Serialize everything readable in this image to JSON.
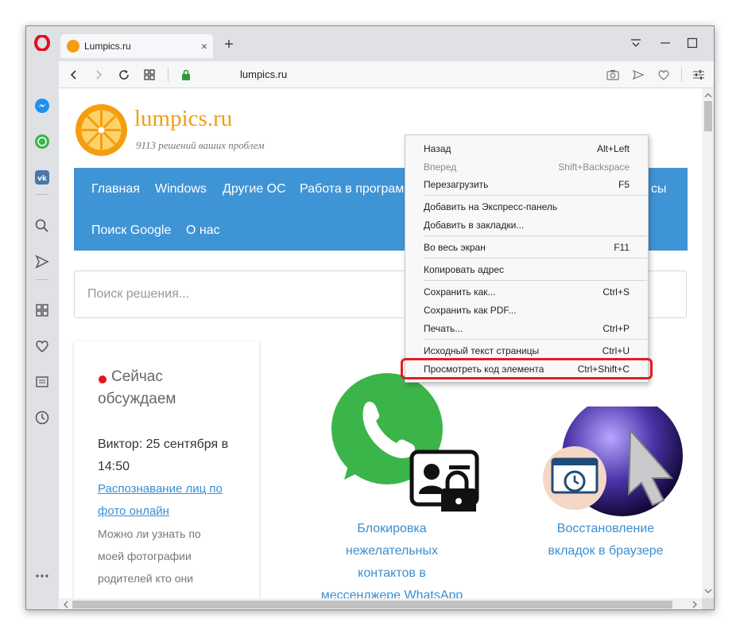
{
  "tab": {
    "title": "Lumpics.ru",
    "close": "×",
    "new": "+"
  },
  "address": {
    "url": "lumpics.ru"
  },
  "site": {
    "title": "lumpics.ru",
    "subtitle": "9113 решений ваших проблем",
    "nav": [
      "Главная",
      "Windows",
      "Другие ОС",
      "Работа в програм",
      "сы",
      "Поиск Google",
      "О нас"
    ],
    "search_placeholder": "Поиск решения..."
  },
  "card": {
    "heading1": "Сейчас",
    "heading2": "обсуждаем",
    "author1": "Виктор: 25 сентября в",
    "author2": "14:50",
    "link1": "Распознавание лиц по",
    "link2": "фото онлайн",
    "body1": "Можно ли узнать по",
    "body2": "моей фотографии",
    "body3": "родителей кто они"
  },
  "articles": [
    {
      "lines": [
        "Блокировка",
        "нежелательных",
        "контактов в",
        "мессенджере WhatsApp"
      ]
    },
    {
      "lines": [
        "Восстановление",
        "вкладок в браузере"
      ]
    }
  ],
  "menu": {
    "items": [
      {
        "label": "Назад",
        "shortcut": "Alt+Left",
        "disabled": false
      },
      {
        "label": "Вперед",
        "shortcut": "Shift+Backspace",
        "disabled": true
      },
      {
        "label": "Перезагрузить",
        "shortcut": "F5",
        "disabled": false
      },
      {
        "label": "Добавить на Экспресс-панель",
        "shortcut": "",
        "disabled": false
      },
      {
        "label": "Добавить в закладки...",
        "shortcut": "",
        "disabled": false
      },
      {
        "label": "Во весь экран",
        "shortcut": "F11",
        "disabled": false
      },
      {
        "label": "Копировать адрес",
        "shortcut": "",
        "disabled": false
      },
      {
        "label": "Сохранить как...",
        "shortcut": "Ctrl+S",
        "disabled": false
      },
      {
        "label": "Сохранить как PDF...",
        "shortcut": "",
        "disabled": false
      },
      {
        "label": "Печать...",
        "shortcut": "Ctrl+P",
        "disabled": false
      },
      {
        "label": "Исходный текст страницы",
        "shortcut": "Ctrl+U",
        "disabled": false
      },
      {
        "label": "Просмотреть код элемента",
        "shortcut": "Ctrl+Shift+C",
        "disabled": false
      }
    ]
  },
  "colors": {
    "accent": "#3f94d6",
    "brand": "#f39c12",
    "highlight": "#e51c23"
  }
}
